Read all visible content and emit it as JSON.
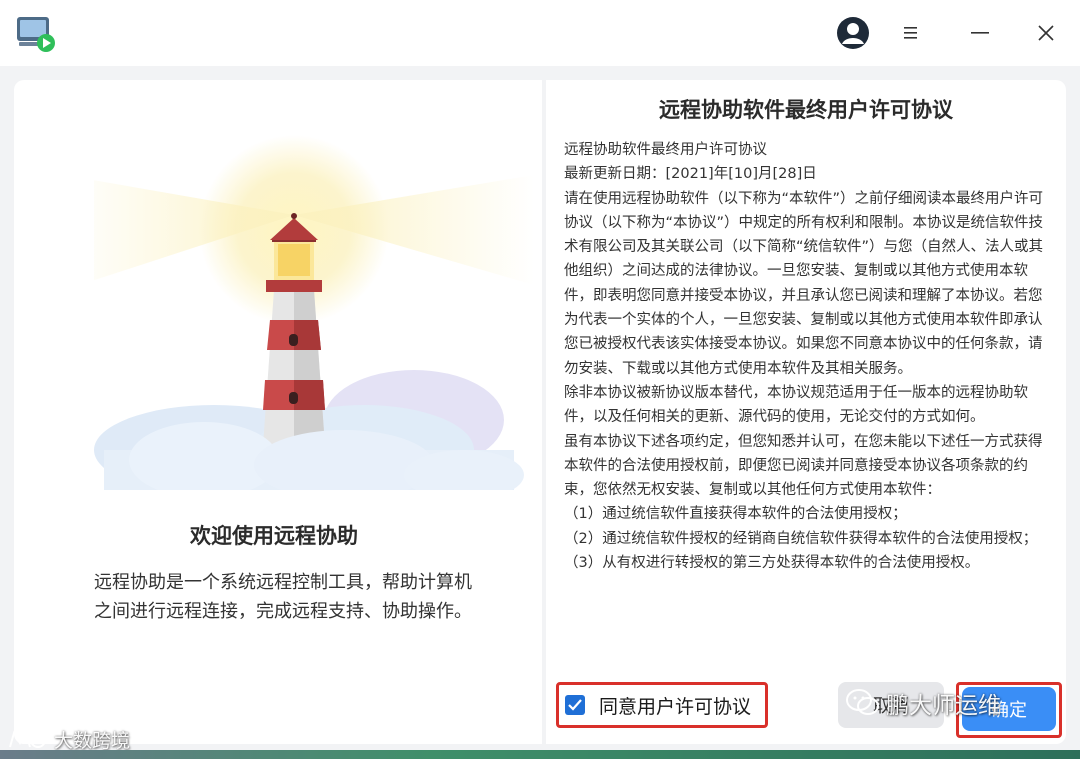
{
  "window": {
    "title_icons": [
      "remote-assist-app-icon",
      "user-avatar-icon",
      "hamburger-menu-icon",
      "minimize-icon",
      "close-icon"
    ]
  },
  "left": {
    "welcome_title": "欢迎使用远程协助",
    "welcome_desc": "远程协助是一个系统远程控制工具，帮助计算机之间进行远程连接，完成远程支持、协助操作。"
  },
  "right": {
    "eula_title": "远程协助软件最终用户许可协议",
    "eula_paragraphs": [
      "远程协助软件最终用户许可协议",
      "最新更新日期：[2021]年[10]月[28]日",
      "请在使用远程协助软件（以下称为“本软件”）之前仔细阅读本最终用户许可协议（以下称为“本协议”）中规定的所有权利和限制。本协议是统信软件技术有限公司及其关联公司（以下简称“统信软件”）与您（自然人、法人或其他组织）之间达成的法律协议。一旦您安装、复制或以其他方式使用本软件，即表明您同意并接受本协议，并且承认您已阅读和理解了本协议。若您为代表一个实体的个人，一旦您安装、复制或以其他方式使用本软件即承认您已被授权代表该实体接受本协议。如果您不同意本协议中的任何条款，请勿安装、下载或以其他方式使用本软件及其相关服务。",
      "除非本协议被新协议版本替代，本协议规范适用于任一版本的远程协助软件，以及任何相关的更新、源代码的使用，无论交付的方式如何。",
      "虽有本协议下述各项约定，但您知悉并认可，在您未能以下述任一方式获得本软件的合法使用授权前，即便您已阅读并同意接受本协议各项条款的约束，您依然无权安装、复制或以其他任何方式使用本软件：",
      "（1）通过统信软件直接获得本软件的合法使用授权；",
      "（2）通过统信软件授权的经销商自统信软件获得本软件的合法使用授权；",
      "（3）从有权进行转授权的第三方处获得本软件的合法使用授权。"
    ],
    "agree_label": "同意用户许可协议",
    "agree_checked": true,
    "cancel_label": "取消",
    "confirm_label": "确定"
  },
  "watermarks": {
    "wechat": "鹏大师运维",
    "bottom_left": "大数跨境"
  },
  "colors": {
    "accent": "#3a8ef6",
    "checkbox": "#1f6fd6",
    "highlight": "#d9302a"
  }
}
